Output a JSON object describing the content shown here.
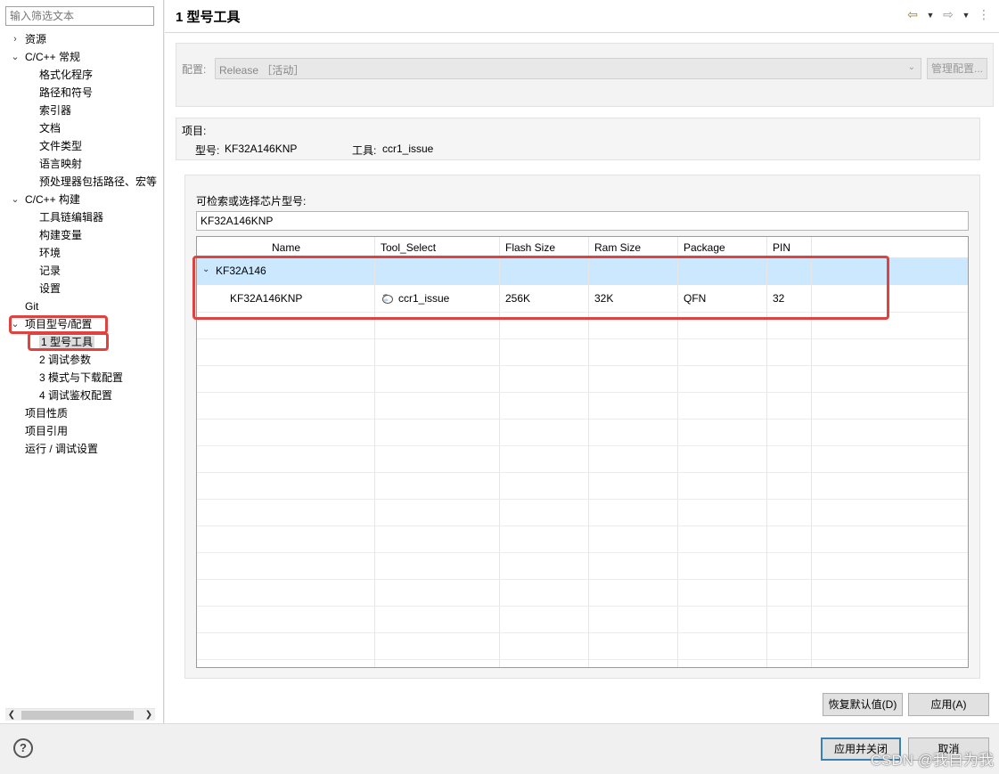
{
  "sidebar": {
    "filter_placeholder": "输入筛选文本",
    "items": [
      {
        "label": "资源",
        "twisty": "›"
      },
      {
        "label": "C/C++ 常规",
        "twisty": "⌄"
      },
      {
        "label": "格式化程序"
      },
      {
        "label": "路径和符号"
      },
      {
        "label": "索引器"
      },
      {
        "label": "文档"
      },
      {
        "label": "文件类型"
      },
      {
        "label": "语言映射"
      },
      {
        "label": "预处理器包括路径、宏等"
      },
      {
        "label": "C/C++ 构建",
        "twisty": "⌄"
      },
      {
        "label": "工具链编辑器"
      },
      {
        "label": "构建变量"
      },
      {
        "label": "环境"
      },
      {
        "label": "记录"
      },
      {
        "label": "设置"
      },
      {
        "label": "Git"
      },
      {
        "label": "项目型号/配置",
        "twisty": "⌄"
      },
      {
        "label": "1 型号工具"
      },
      {
        "label": "2 调试参数"
      },
      {
        "label": "3 模式与下载配置"
      },
      {
        "label": "4 调试鉴权配置"
      },
      {
        "label": "项目性质"
      },
      {
        "label": "项目引用"
      },
      {
        "label": "运行 / 调试设置"
      }
    ]
  },
  "main": {
    "title": "1 型号工具",
    "config": {
      "label": "配置:",
      "value": "Release ［活动］",
      "manage_button": "管理配置..."
    },
    "project": {
      "heading": "项目:",
      "model_label": "型号:",
      "model_value": "KF32A146KNP",
      "tool_label": "工具:",
      "tool_value": "ccr1_issue"
    },
    "chip": {
      "search_label": "可检索或选择芯片型号:",
      "search_value": "KF32A146KNP",
      "columns": [
        "Name",
        "Tool_Select",
        "Flash Size",
        "Ram Size",
        "Package",
        "PIN"
      ],
      "group": "KF32A146",
      "rows": [
        {
          "name": "KF32A146KNP",
          "tool": "ccr1_issue",
          "flash": "256K",
          "ram": "32K",
          "package": "QFN",
          "pin": "32"
        }
      ]
    },
    "restore_button": "恢复默认值(D)",
    "apply_button": "应用(A)"
  },
  "footer": {
    "help": "?",
    "apply_close_button": "应用并关闭",
    "cancel_button": "取消",
    "watermark": "CSDN @我自为我"
  },
  "colors": {
    "highlight_box": "#e0433f",
    "selected_row": "#cce8ff"
  }
}
